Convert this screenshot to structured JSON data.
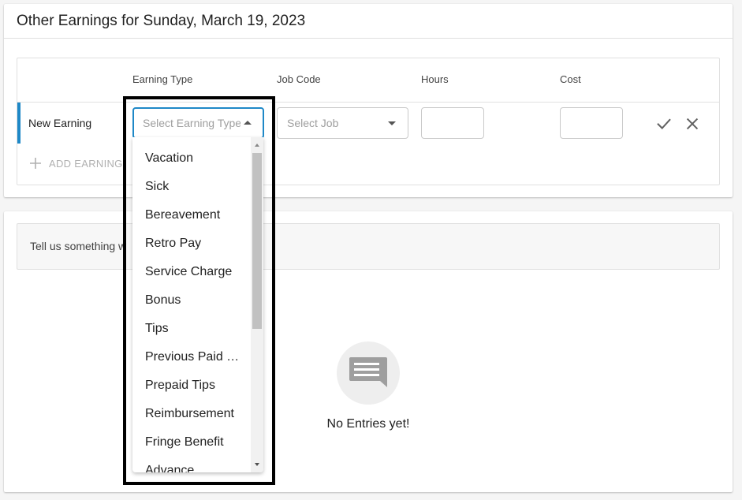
{
  "card_title": "Other Earnings for Sunday, March 19, 2023",
  "columns": {
    "earning_type": "Earning Type",
    "job_code": "Job Code",
    "hours": "Hours",
    "cost": "Cost"
  },
  "row": {
    "label": "New Earning",
    "earning_placeholder": "Select Earning Type",
    "job_placeholder": "Select Job",
    "hours_value": "",
    "cost_value": ""
  },
  "add_earning_label": "ADD EARNING",
  "note_placeholder": "Tell us something w",
  "empty_state": {
    "icon": "comment-icon",
    "text": "No Entries yet!"
  },
  "dropdown": {
    "open": true,
    "items": [
      "Vacation",
      "Sick",
      "Bereavement",
      "Retro Pay",
      "Service Charge",
      "Bonus",
      "Tips",
      "Previous Paid …",
      "Prepaid Tips",
      "Reimbursement",
      "Fringe Benefit",
      "Advance"
    ]
  },
  "colors": {
    "accent": "#1e88c7",
    "highlight_frame": "#000000"
  },
  "icons": {
    "confirm": "check-icon",
    "cancel": "close-icon",
    "add": "plus-icon",
    "earning_arrow": "arrow-up-icon",
    "job_arrow": "arrow-down-icon"
  }
}
